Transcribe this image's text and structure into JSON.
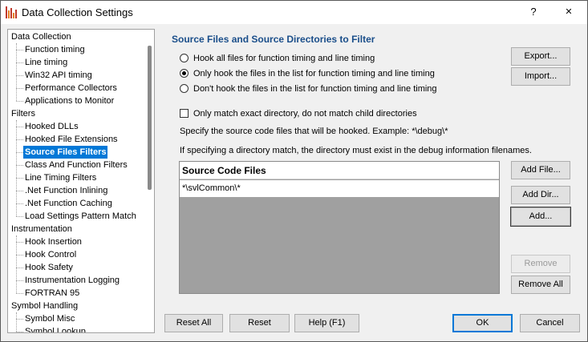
{
  "window": {
    "title": "Data Collection Settings",
    "help_glyph": "?",
    "close_glyph": "✕"
  },
  "icons": {
    "app": "bar-chart-icon",
    "help": "help-icon",
    "close": "close-icon"
  },
  "colors": {
    "selection": "#0078d7",
    "section_title": "#1a4e8a",
    "list_bg": "#a0a0a0"
  },
  "tree": {
    "selected": "Source Files Filters",
    "groups": [
      {
        "label": "Data Collection",
        "children": [
          "Function timing",
          "Line timing",
          "Win32 API timing",
          "Performance Collectors",
          "Applications to Monitor"
        ]
      },
      {
        "label": "Filters",
        "children": [
          "Hooked DLLs",
          "Hooked File Extensions",
          "Source Files Filters",
          "Class And Function Filters",
          "Line Timing Filters",
          ".Net Function Inlining",
          ".Net Function Caching",
          "Load Settings Pattern Match"
        ]
      },
      {
        "label": "Instrumentation",
        "children": [
          "Hook Insertion",
          "Hook Control",
          "Hook Safety",
          "Instrumentation Logging",
          "FORTRAN 95"
        ]
      },
      {
        "label": "Symbol Handling",
        "children": [
          "Symbol Misc",
          "Symbol Lookup"
        ]
      }
    ]
  },
  "panel": {
    "title": "Source Files and Source Directories to Filter",
    "radios": [
      {
        "label": "Hook all files for function timing and line timing",
        "selected": false
      },
      {
        "label": "Only hook the files in the list for function timing and line timing",
        "selected": true
      },
      {
        "label": "Don't hook the files in the list for function timing and line timing",
        "selected": false
      }
    ],
    "exact_dir_checkbox": {
      "label": "Only match exact directory, do not match child directories",
      "checked": false
    },
    "hint1": "Specify the source code files that will be hooked. Example: *\\debug\\*",
    "hint2": "If specifying a directory match, the directory must exist in the debug information filenames.",
    "list_header": "Source Code Files",
    "list_items": [
      "*\\svlCommon\\*"
    ],
    "buttons": {
      "export": "Export...",
      "import": "Import...",
      "add_file": "Add File...",
      "add_dir": "Add Dir...",
      "add": "Add...",
      "remove": "Remove",
      "remove_all": "Remove All"
    }
  },
  "footer": {
    "reset_all": "Reset All",
    "reset": "Reset",
    "help": "Help (F1)",
    "ok": "OK",
    "cancel": "Cancel"
  }
}
